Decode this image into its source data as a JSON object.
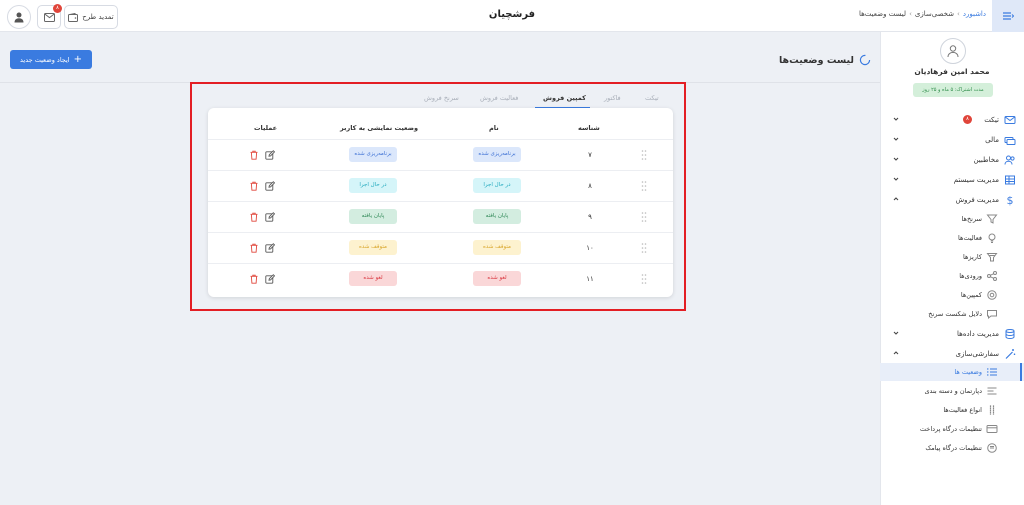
{
  "header": {
    "app_title": "فرشچیان",
    "breadcrumb": [
      "داشبورد",
      "شخصی‌سازی",
      "لیست وضعیت‌ها"
    ],
    "renew_label": "تمدید طرح",
    "mail_badge": "۸"
  },
  "sidebar": {
    "user_name": "محمد امین فرهادیان",
    "subscription": "مدت اشتراک: ۵ ماه و ۲۵ روز",
    "items": [
      {
        "label": "تیکت",
        "badge": "۸"
      },
      {
        "label": "مالی"
      },
      {
        "label": "مخاطبین"
      },
      {
        "label": "مدیریت سیستم"
      },
      {
        "label": "مدیریت فروش"
      }
    ],
    "sales_sub": [
      "سرنخ‌ها",
      "فعالیت‌ها",
      "کاریزها",
      "ورودی‌ها",
      "کمپین‌ها",
      "دلایل شکست سرنخ"
    ],
    "data_mgmt": "مدیریت داده‌ها",
    "customization": "سفارشی‌سازی",
    "custom_sub": [
      "وضعیت ها",
      "دپارتمان و دسته بندی",
      "انواع فعالیت‌ها",
      "تنظیمات درگاه پرداخت",
      "تنظیمات درگاه پیامک"
    ]
  },
  "page": {
    "title": "لیست وضعیت‌ها",
    "create_button": "ایجاد وضعیت جدید"
  },
  "tabs": [
    "تیکت",
    "فاکتور",
    "کمپین فروش",
    "فعالیت فروش",
    "سرنخ فروش"
  ],
  "table": {
    "headers": {
      "id": "شناسه",
      "name": "نام",
      "display": "وضعیت نمایشی به کاربر",
      "actions": "عملیات"
    },
    "rows": [
      {
        "id": "۷",
        "name": "برنامه‌ریزی شده",
        "display": "برنامه‌ریزی شده"
      },
      {
        "id": "۸",
        "name": "در حال اجرا",
        "display": "در حال اجرا"
      },
      {
        "id": "۹",
        "name": "پایان یافته",
        "display": "پایان یافته"
      },
      {
        "id": "۱۰",
        "name": "متوقف شده",
        "display": "متوقف شده"
      },
      {
        "id": "۱۱",
        "name": "لغو شده",
        "display": "لغو شده"
      }
    ]
  },
  "colors": {
    "accent": "#3a7be0",
    "highlight_border": "#e31e24",
    "status_blue": "#3b6fd4",
    "status_cyan": "#21a9be",
    "status_green": "#2a8552",
    "status_yellow": "#d8a52a",
    "status_red": "#d9343d"
  }
}
